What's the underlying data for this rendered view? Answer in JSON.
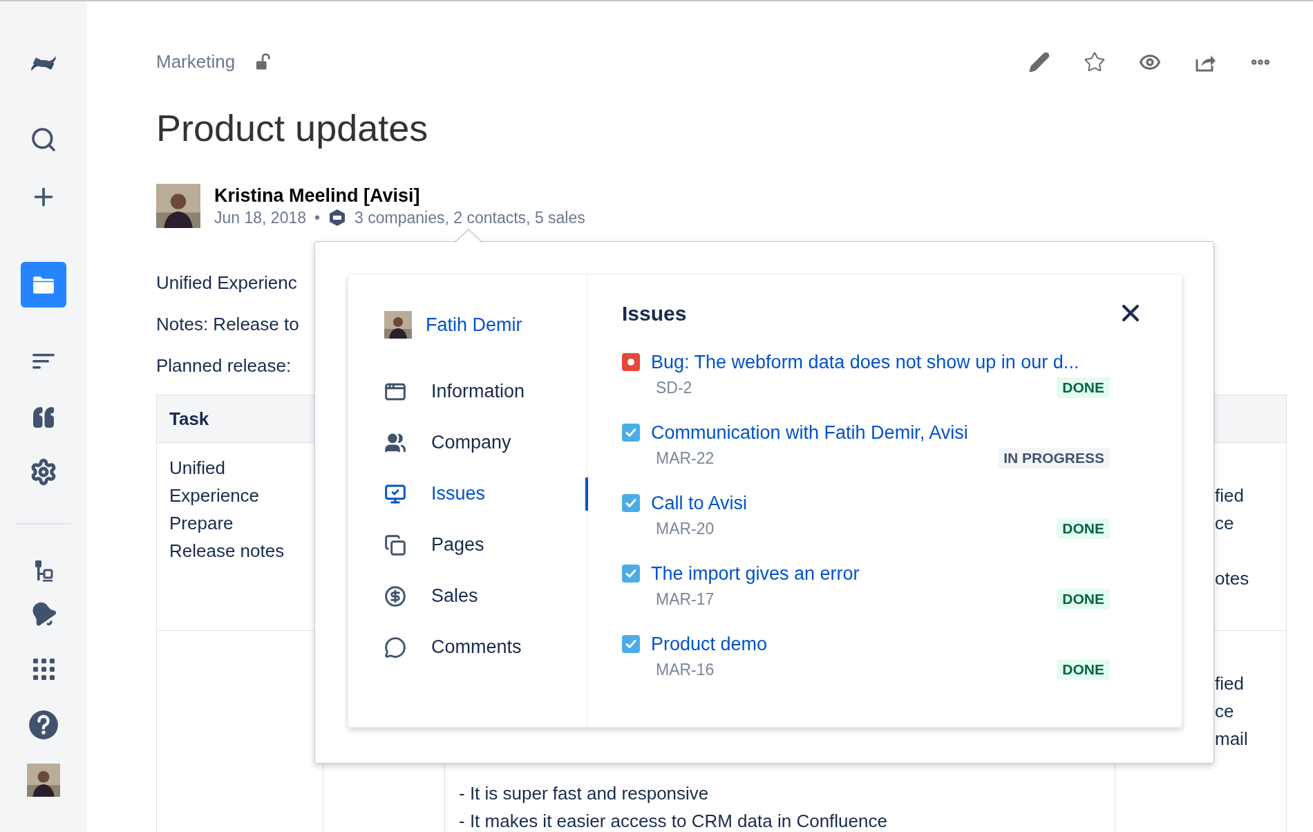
{
  "sidebar": {
    "top_items": [
      {
        "kind": "logo",
        "selected": false
      },
      {
        "kind": "search",
        "selected": false
      },
      {
        "kind": "create",
        "selected": false
      },
      {
        "kind": "folder",
        "selected": true
      },
      {
        "kind": "lines",
        "selected": false
      },
      {
        "kind": "quote",
        "selected": false
      },
      {
        "kind": "settings",
        "selected": false
      }
    ],
    "bottom_items": [
      {
        "kind": "tree",
        "selected": false
      },
      {
        "kind": "bell",
        "selected": false
      },
      {
        "kind": "apps",
        "selected": false
      },
      {
        "kind": "help",
        "selected": false
      },
      {
        "kind": "avatar",
        "selected": false
      }
    ]
  },
  "breadcrumb": "Marketing",
  "toolbar": [
    {
      "kind": "edit"
    },
    {
      "kind": "star"
    },
    {
      "kind": "watch"
    },
    {
      "kind": "share"
    },
    {
      "kind": "more"
    }
  ],
  "title": "Product updates",
  "author": {
    "name": "Kristina Meelind [Avisi]",
    "date": "Jun 18, 2018",
    "separator": "•",
    "crm_summary": "3 companies, 2 contacts, 5 sales"
  },
  "paragraphs": [
    "Unified Experienc",
    "Notes: Release to",
    "Planned release:"
  ],
  "table": {
    "columns": [
      "Task"
    ],
    "rows": [
      {
        "task": [
          "Unified",
          "Experience",
          "Prepare",
          "Release notes"
        ],
        "column_4": [
          "fied",
          "ce",
          "otes"
        ]
      },
      {
        "column_3": [
          "- It is super fast and responsive",
          "- It makes it easier access to CRM data in Confluence"
        ],
        "column_4": [
          "fied",
          "ce",
          "mail"
        ]
      }
    ]
  },
  "popover": {
    "contact": "Fatih Demir",
    "nav": [
      {
        "kind": "information",
        "label": "Information",
        "selected": false
      },
      {
        "kind": "company",
        "label": "Company",
        "selected": false
      },
      {
        "kind": "issues",
        "label": "Issues",
        "selected": true
      },
      {
        "kind": "pages",
        "label": "Pages",
        "selected": false
      },
      {
        "kind": "sales",
        "label": "Sales",
        "selected": false
      },
      {
        "kind": "comments",
        "label": "Comments",
        "selected": false
      }
    ],
    "panel": {
      "title": "Issues",
      "issues": [
        {
          "kind": "bug",
          "title": "Bug: The webform data does not show up in our d...",
          "key": "SD-2",
          "status": {
            "text": "DONE",
            "kind": "success"
          }
        },
        {
          "kind": "task",
          "title": "Communication with Fatih Demir, Avisi",
          "key": "MAR-22",
          "status": {
            "text": "IN PROGRESS",
            "kind": "default"
          }
        },
        {
          "kind": "task",
          "title": "Call to Avisi",
          "key": "MAR-20",
          "status": {
            "text": "DONE",
            "kind": "success"
          }
        },
        {
          "kind": "task",
          "title": "The import gives an error",
          "key": "MAR-17",
          "status": {
            "text": "DONE",
            "kind": "success"
          }
        },
        {
          "kind": "task",
          "title": "Product demo",
          "key": "MAR-16",
          "status": {
            "text": "DONE",
            "kind": "success"
          }
        }
      ]
    }
  }
}
